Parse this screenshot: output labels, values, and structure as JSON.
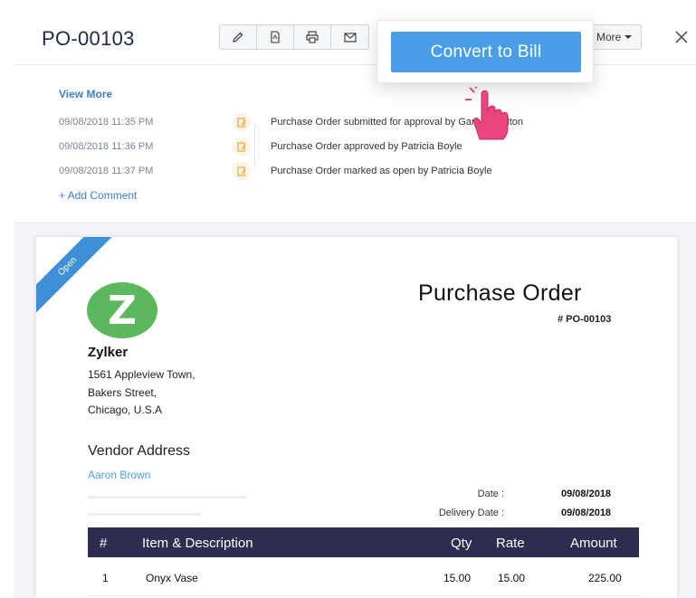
{
  "header": {
    "title": "PO-00103",
    "more_label": "More",
    "toolbar_icons": [
      "edit-icon",
      "pdf-icon",
      "print-icon",
      "email-icon"
    ]
  },
  "popup": {
    "convert_label": "Convert to Bill"
  },
  "history": {
    "view_more": "View More",
    "entries": [
      {
        "time": "09/08/2018  11:35 PM",
        "text": "Purchase Order submitted for approval by Gary D Walton"
      },
      {
        "time": "09/08/2018  11:36 PM",
        "text": "Purchase Order approved by Patricia Boyle"
      },
      {
        "time": "09/08/2018  11:37 PM",
        "text": "Purchase Order marked as open by Patricia Boyle"
      }
    ],
    "add_comment": "+ Add Comment"
  },
  "document": {
    "status": "Open",
    "logo_letter": "Z",
    "company": "Zylker",
    "address": [
      "1561 Appleview Town,",
      "Bakers Street,",
      "Chicago, U.S.A"
    ],
    "doc_title": "Purchase Order",
    "doc_number": "# PO-00103",
    "vendor_label": "Vendor Address",
    "vendor_name": "Aaron Brown",
    "date_label": "Date :",
    "date_value": "09/08/2018",
    "delivery_label": "Delivery Date :",
    "delivery_value": "09/08/2018",
    "table": {
      "headers": [
        "#",
        "Item & Description",
        "Qty",
        "Rate",
        "Amount"
      ],
      "rows": [
        {
          "num": "1",
          "item": "Onyx Vase",
          "qty": "15.00",
          "rate": "15.00",
          "amount": "225.00"
        }
      ]
    }
  },
  "colors": {
    "accent": "#4a9ee8",
    "table_header": "#2e2c4f",
    "logo": "#5cb85c",
    "ribbon": "#3d8fd8",
    "history_icon": "#f0a020"
  }
}
